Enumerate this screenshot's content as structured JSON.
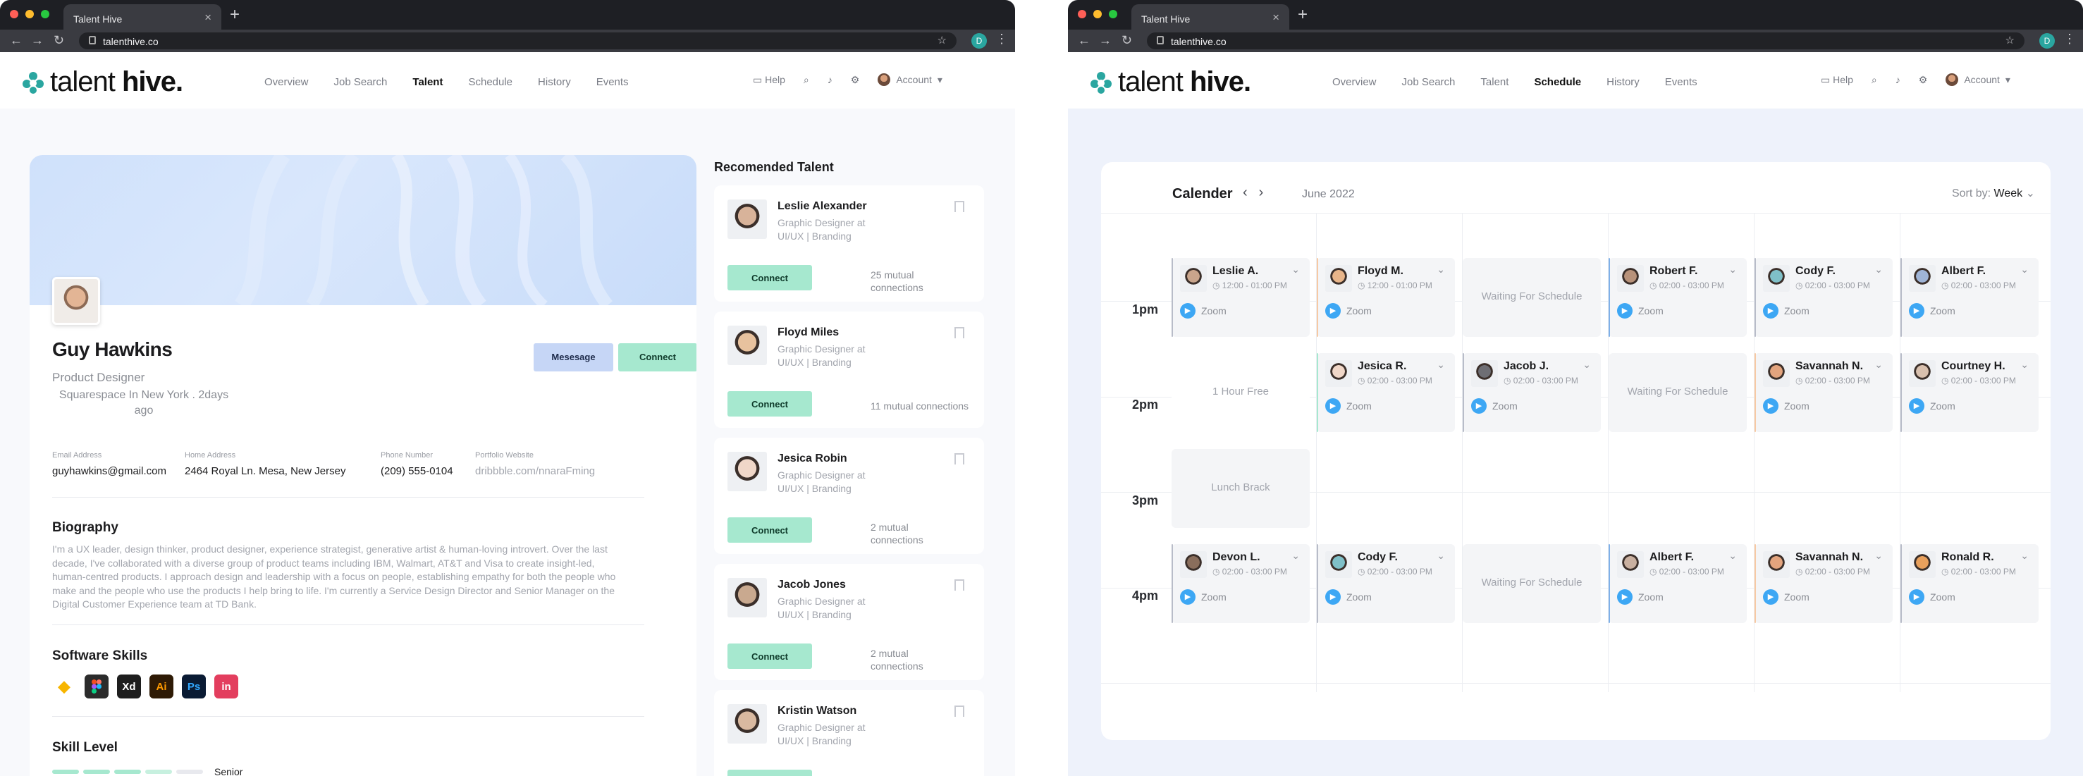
{
  "windows": [
    {
      "tab_title": "Talent Hive",
      "url": "talenthive.co",
      "profile_initial": "D",
      "logo": {
        "light": "talent ",
        "bold": "hive."
      },
      "nav": [
        "Overview",
        "Job Search",
        "Talent",
        "Schedule",
        "History",
        "Events"
      ],
      "nav_active": "Talent",
      "help_label": "Help",
      "account_label": "Account"
    },
    {
      "tab_title": "Talent Hive",
      "url": "talenthive.co",
      "profile_initial": "D",
      "logo": {
        "light": "talent ",
        "bold": "hive."
      },
      "nav": [
        "Overview",
        "Job Search",
        "Talent",
        "Schedule",
        "History",
        "Events"
      ],
      "nav_active": "Schedule",
      "help_label": "Help",
      "account_label": "Account"
    }
  ],
  "profile": {
    "name": "Guy Hawkins",
    "role": "Product Designer",
    "location": "Squarespace In New York . 2days ago",
    "message_button": "Mesesage",
    "connect_button": "Connect",
    "contacts": [
      {
        "label": "Email Address",
        "value": "guyhawkins@gmail.com"
      },
      {
        "label": "Home Address",
        "value": "2464 Royal Ln. Mesa, New Jersey"
      },
      {
        "label": "Phone Number",
        "value": "(209) 555-0104"
      },
      {
        "label": "Portfolio Website",
        "value": "dribbble.com/nnaraFming"
      }
    ],
    "biography_title": "Biography",
    "biography": "I'm a UX leader, design thinker, product designer, experience strategist, generative artist & human-loving introvert. Over the last decade, I've collaborated with a diverse group of product teams including IBM, Walmart, AT&T and Visa to create insight-led, human-centred products. I approach design and leadership with a focus on people, establishing empathy for both the people who make and the people who use the products I help bring to life. I'm currently a Service Design Director and Senior Manager on the Digital Customer Experience team at TD Bank.",
    "skills_title": "Software Skills",
    "skills": [
      {
        "icon": "sketch-icon",
        "label": "",
        "bg": "#ffffff",
        "fg": "#f7b500"
      },
      {
        "icon": "figma-icon",
        "label": "",
        "bg": "#2b2b2b",
        "fg": "#ffffff"
      },
      {
        "icon": "xd-icon",
        "label": "Xd",
        "bg": "#1e1e1e",
        "fg": "#ffffff"
      },
      {
        "icon": "illustrator-icon",
        "label": "Ai",
        "bg": "#2e1a05",
        "fg": "#ff9a00"
      },
      {
        "icon": "photoshop-icon",
        "label": "Ps",
        "bg": "#0a1b33",
        "fg": "#31a8ff"
      },
      {
        "icon": "invision-icon",
        "label": "in",
        "bg": "#e33e5e",
        "fg": "#ffffff"
      }
    ],
    "skill_level_title": "Skill Level",
    "skill_level_label": "Senior",
    "skill_level_fraction": 0.8
  },
  "recommended": {
    "title": "Recomended Talent",
    "people": [
      {
        "name": "Leslie Alexander",
        "desc": "Graphic Designer at UI/UX | Branding",
        "button": "Connect",
        "mutual": "25 mutual connections",
        "photo": "#d8b39a"
      },
      {
        "name": "Floyd Miles",
        "desc": "Graphic Designer at UI/UX | Branding",
        "button": "Connect",
        "mutual": "11 mutual connections",
        "photo": "#e8c29e"
      },
      {
        "name": "Jesica Robin",
        "desc": "Graphic Designer at UI/UX | Branding",
        "button": "Connect",
        "mutual": "2 mutual connections",
        "photo": "#f0d7c8"
      },
      {
        "name": "Jacob Jones",
        "desc": "Graphic Designer at UI/UX | Branding",
        "button": "Connect",
        "mutual": "2 mutual connections",
        "photo": "#c9a98f"
      },
      {
        "name": "Kristin Watson",
        "desc": "Graphic Designer at UI/UX | Branding",
        "button": "Connect",
        "mutual": "",
        "photo": "#d9b9a0"
      }
    ]
  },
  "calendar": {
    "title": "Calender",
    "month": "June 2022",
    "sort_label": "Sort by:",
    "sort_value": "Week",
    "time_labels": [
      "1pm",
      "2pm",
      "3pm",
      "4pm"
    ],
    "rows": [
      [
        {
          "type": "event",
          "name": "Leslie A.",
          "time": "12:00 - 01:00 PM",
          "zoom": "Zoom",
          "accent": "#b8bcc8",
          "photo": "#c9a58c"
        },
        {
          "type": "event",
          "name": "Floyd M.",
          "time": "12:00 - 01:00 PM",
          "zoom": "Zoom",
          "accent": "#f7c9a3",
          "photo": "#e8b58a"
        },
        {
          "type": "text",
          "text": "Waiting For Schedule"
        },
        {
          "type": "event",
          "name": "Robert F.",
          "time": "02:00 - 03:00 PM",
          "zoom": "Zoom",
          "accent": "#7fb0e8",
          "photo": "#b8927a"
        },
        {
          "type": "event",
          "name": "Cody F.",
          "time": "02:00 - 03:00 PM",
          "zoom": "Zoom",
          "accent": "#b8bcc8",
          "photo": "#7fc0c8"
        },
        {
          "type": "event",
          "name": "Albert F.",
          "time": "02:00 - 03:00 PM",
          "zoom": "Zoom",
          "accent": "#b8bcc8",
          "photo": "#9fb4d6"
        }
      ],
      [
        {
          "type": "text",
          "text": "1 Hour Free"
        },
        {
          "type": "event",
          "name": "Jesica R.",
          "time": "02:00 - 03:00 PM",
          "zoom": "Zoom",
          "accent": "#a6e8cf",
          "photo": "#f0d7c8"
        },
        {
          "type": "event",
          "name": "Jacob J.",
          "time": "02:00 - 03:00 PM",
          "zoom": "Zoom",
          "accent": "#b8bcc8",
          "photo": "#6e6e74"
        },
        {
          "type": "text",
          "text": "Waiting For Schedule"
        },
        {
          "type": "event",
          "name": "Savannah N.",
          "time": "02:00 - 03:00 PM",
          "zoom": "Zoom",
          "accent": "#f7c9a3",
          "photo": "#e3a47e"
        },
        {
          "type": "event",
          "name": "Courtney H.",
          "time": "02:00 - 03:00 PM",
          "zoom": "Zoom",
          "accent": "#b8bcc8",
          "photo": "#d8c0ae"
        }
      ],
      [
        {
          "type": "text",
          "text": "Lunch Brack"
        }
      ],
      [
        {
          "type": "event",
          "name": "Devon L.",
          "time": "02:00 - 03:00 PM",
          "zoom": "Zoom",
          "accent": "#b8bcc8",
          "photo": "#8a6e5c"
        },
        {
          "type": "event",
          "name": "Cody F.",
          "time": "02:00 - 03:00 PM",
          "zoom": "Zoom",
          "accent": "#b8bcc8",
          "photo": "#7fc0c8"
        },
        {
          "type": "text",
          "text": "Waiting For Schedule"
        },
        {
          "type": "event",
          "name": "Albert F.",
          "time": "02:00 - 03:00 PM",
          "zoom": "Zoom",
          "accent": "#7fb0e8",
          "photo": "#c9b0a0"
        },
        {
          "type": "event",
          "name": "Savannah N.",
          "time": "02:00 - 03:00 PM",
          "zoom": "Zoom",
          "accent": "#f7c9a3",
          "photo": "#e3a47e"
        },
        {
          "type": "event",
          "name": "Ronald R.",
          "time": "02:00 - 03:00 PM",
          "zoom": "Zoom",
          "accent": "#b8bcc8",
          "photo": "#e8a05c"
        }
      ]
    ]
  },
  "colors": {
    "accent_green": "#a6e8cf",
    "accent_blue": "#c6d6f6",
    "zoom_blue": "#3da7f4"
  }
}
